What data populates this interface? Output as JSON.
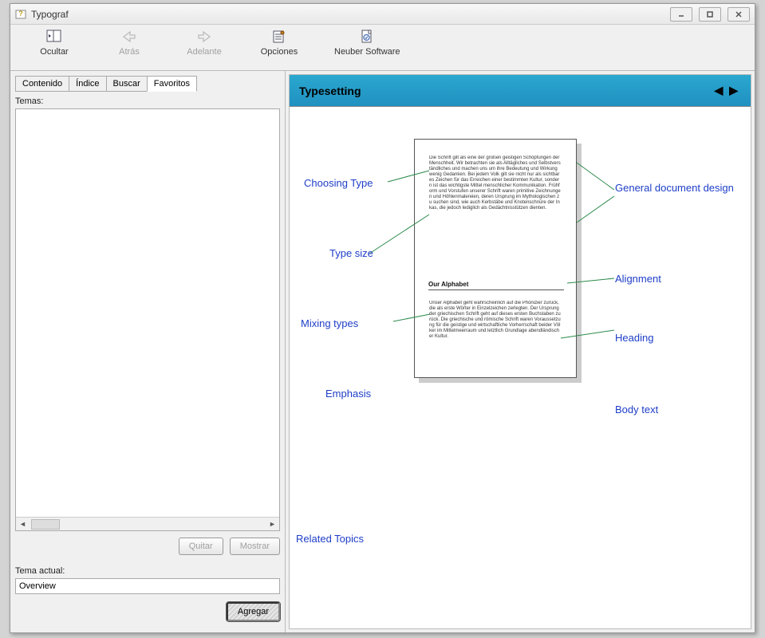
{
  "window": {
    "title": "Typograf"
  },
  "toolbar": {
    "hide": "Ocultar",
    "back": "Atrás",
    "forward": "Adelante",
    "options": "Opciones",
    "vendor": "Neuber Software"
  },
  "tabs": {
    "content": "Contenido",
    "index": "Índice",
    "search": "Buscar",
    "favorites": "Favoritos"
  },
  "favorites": {
    "topics_label": "Temas:",
    "remove": "Quitar",
    "display": "Mostrar",
    "current_topic_label": "Tema actual:",
    "current_topic_value": "Overview",
    "add": "Agregar"
  },
  "content": {
    "title": "Typesetting",
    "callouts": {
      "choosing_type": "Choosing Type",
      "type_size": "Type size",
      "mixing_types": "Mixing types",
      "emphasis": "Emphasis",
      "general_design": "General document design",
      "alignment": "Alignment",
      "heading": "Heading",
      "body_text": "Body text"
    },
    "related": "Related Topics",
    "preview": {
      "subheading": "Our Alphabet",
      "para1": "Die Schrift gilt als eine der großen geistigen Schöpfungen der Menschheit. Wir betrachten sie als Alltägliches und Selbstverständliches und machen uns um ihre Bedeutung und Wirkung wenig Gedanken. Bei jedem Volk gilt sie nicht nur als sichtbares Zeichen für das Erreichen einer bestimmten Kultur, sondern ist das wichtigste Mittel menschlicher Kommunikation. Frühform und Vorstufen unserer Schrift waren primitive Zeichnungen und Höhlenmalereien, deren Ursprung im Mythologischen zu suchen sind, wie auch Kerbstäbe und Knotenschnüre der Inkas, die jedoch lediglich als Gedächtnisstützen dienten.",
      "para2": "Unser Alphabet geht wahrscheinlich auf die Phönizier zurück, die als erste Wörter in Einzelzeichen zerlegten. Der Ursprung der griechischen Schrift geht auf dieses ersten Buchstaben zurück. Die griechische und römische Schrift waren Voraussetzung für die geistige und wirtschaftliche Vorherrschaft beider Völker im Mittelmeerraum und letztlich Grundlage abendländischer Kultur."
    }
  }
}
